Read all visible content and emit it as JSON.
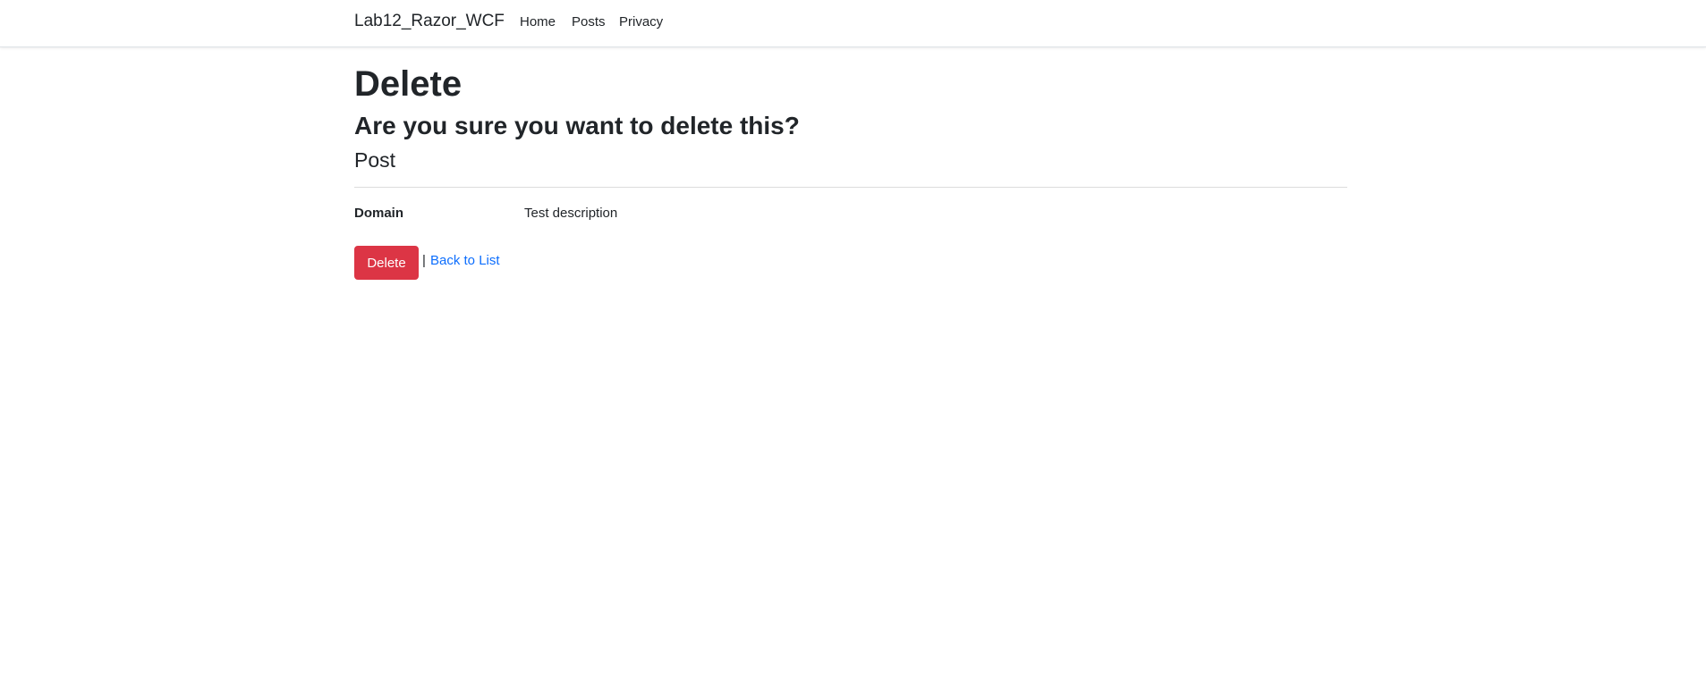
{
  "navbar": {
    "brand": "Lab12_Razor_WCF",
    "links": [
      "Home",
      "Posts",
      "Privacy"
    ]
  },
  "main": {
    "title": "Delete",
    "confirm_text": "Are you sure you want to delete this?",
    "entity_name": "Post",
    "fields": [
      {
        "label": "Domain",
        "value": "Test description"
      }
    ],
    "delete_button": "Delete",
    "separator": "|",
    "back_link": "Back to List"
  },
  "colors": {
    "danger": "#dc3545",
    "link": "#0d6efd",
    "text": "#212529"
  }
}
